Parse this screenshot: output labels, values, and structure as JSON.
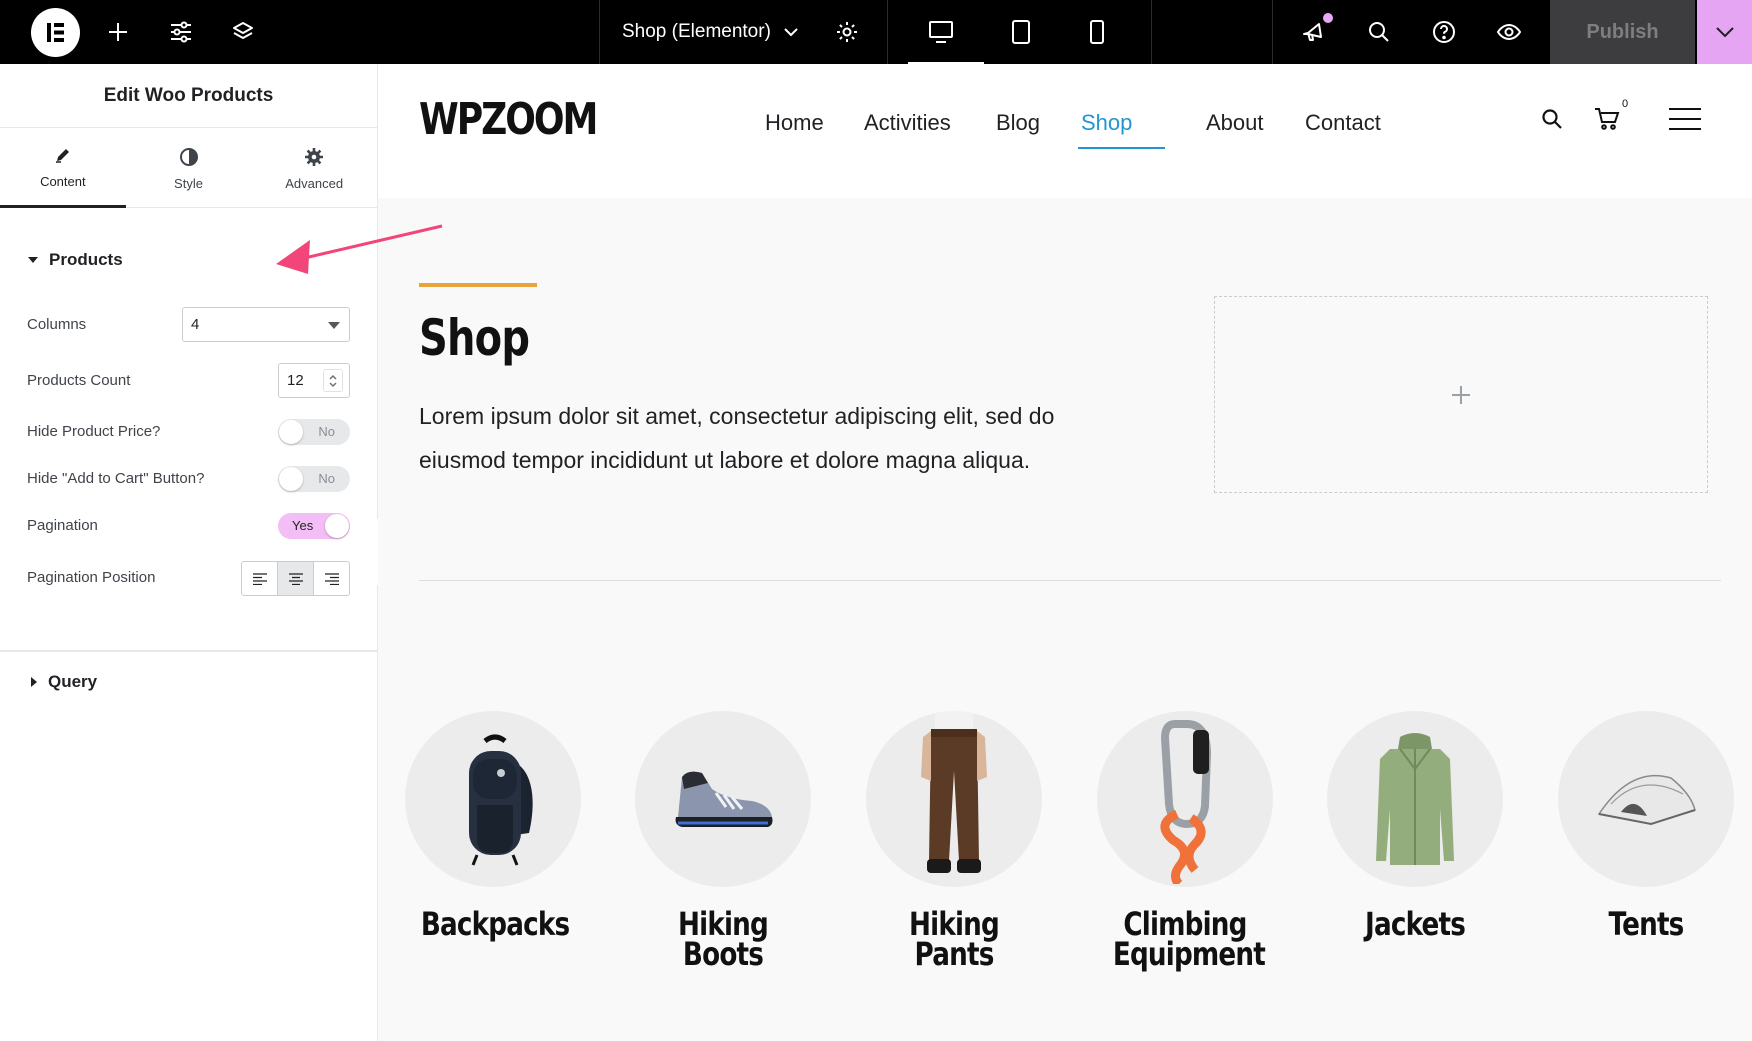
{
  "topbar": {
    "doc_title": "Shop (Elementor)",
    "publish_label": "Publish",
    "colors": {
      "bg": "#000000",
      "publish_more": "#e6a5f2",
      "notification_dot": "#e9a8f6"
    }
  },
  "panel": {
    "title": "Edit Woo Products",
    "tabs": [
      {
        "label": "Content",
        "icon": "pencil-icon",
        "active": true
      },
      {
        "label": "Style",
        "icon": "half-circle-icon",
        "active": false
      },
      {
        "label": "Advanced",
        "icon": "gear-icon",
        "active": false
      }
    ],
    "products_section": "Products",
    "query_section": "Query",
    "controls": {
      "columns": {
        "label": "Columns",
        "value": "4"
      },
      "products_count": {
        "label": "Products Count",
        "value": "12"
      },
      "hide_price": {
        "label": "Hide Product Price?",
        "state": "No"
      },
      "hide_cart": {
        "label": "Hide \"Add to Cart\" Button?",
        "state": "No"
      },
      "pagination": {
        "label": "Pagination",
        "state": "Yes"
      },
      "pagination_position": {
        "label": "Pagination Position",
        "selected": "center"
      }
    }
  },
  "site": {
    "logo": "WPZOOM",
    "nav": [
      "Home",
      "Activities",
      "Blog",
      "Shop",
      "About",
      "Contact"
    ],
    "active_nav": "Shop",
    "cart_count": "0",
    "accent_color": "#2196d3",
    "page_title": "Shop",
    "description": "Lorem ipsum dolor sit amet, consectetur adipiscing elit, sed do eiusmod tempor incididunt ut labore et dolore magna aliqua.",
    "categories": [
      {
        "name": "Backpacks",
        "image": "backpack"
      },
      {
        "name": "Hiking Boots",
        "image": "boot"
      },
      {
        "name": "Hiking Pants",
        "image": "pants"
      },
      {
        "name": "Climbing Equipment",
        "image": "carabiner-rope"
      },
      {
        "name": "Jackets",
        "image": "jacket"
      },
      {
        "name": "Tents",
        "image": "tent"
      }
    ]
  }
}
